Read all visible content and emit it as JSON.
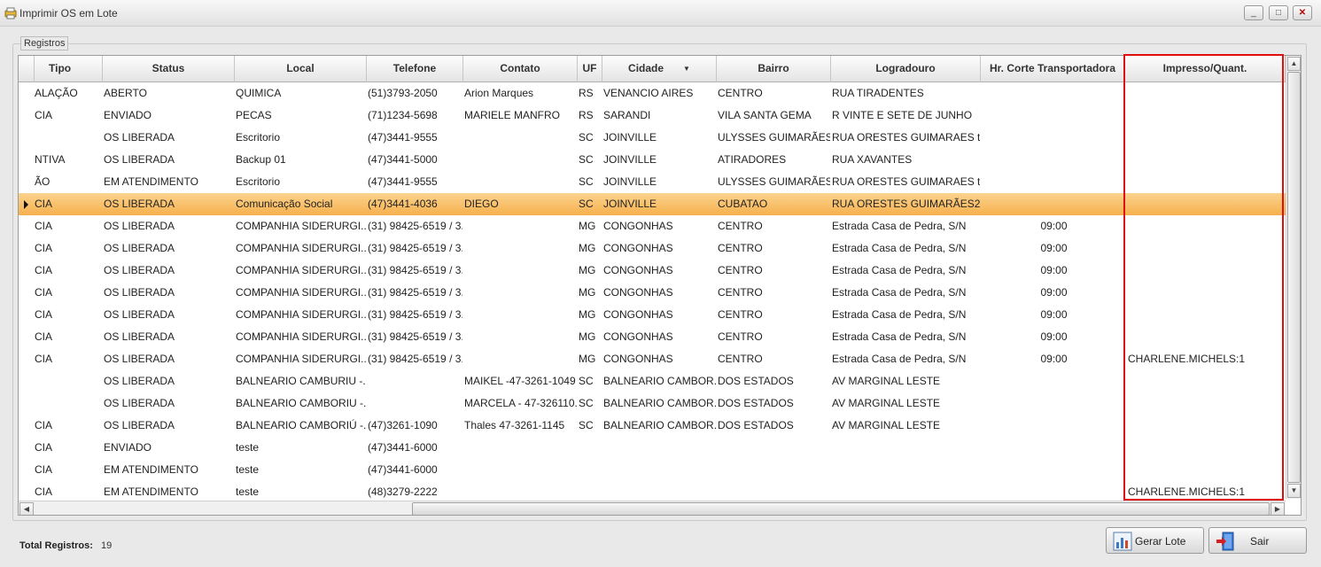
{
  "window": {
    "title": "Imprimir OS em Lote",
    "min_glyph": "_",
    "max_glyph": "□",
    "close_glyph": "✕"
  },
  "groupbox": {
    "label": "Registros"
  },
  "grid": {
    "columns": [
      {
        "key": "tipo",
        "label": "Tipo"
      },
      {
        "key": "status",
        "label": "Status"
      },
      {
        "key": "local",
        "label": "Local"
      },
      {
        "key": "telefone",
        "label": "Telefone"
      },
      {
        "key": "contato",
        "label": "Contato"
      },
      {
        "key": "uf",
        "label": "UF"
      },
      {
        "key": "cidade",
        "label": "Cidade",
        "sorted": true
      },
      {
        "key": "bairro",
        "label": "Bairro"
      },
      {
        "key": "logradouro",
        "label": "Logradouro"
      },
      {
        "key": "hr_corte",
        "label": "Hr. Corte Transportadora"
      },
      {
        "key": "impresso",
        "label": "Impresso/Quant."
      }
    ],
    "sort_glyph": "▼",
    "rows": [
      {
        "tipo": "ALAÇÃO",
        "status": "ABERTO",
        "local": "QUIMICA",
        "telefone": "(51)3793-2050",
        "contato": "Arion Marques",
        "uf": "RS",
        "cidade": "VENANCIO AIRES",
        "bairro": "CENTRO",
        "logradouro": "RUA TIRADENTES",
        "hr_corte": "",
        "impresso": ""
      },
      {
        "tipo": "CIA",
        "status": "ENVIADO",
        "local": "PECAS",
        "telefone": "(71)1234-5698",
        "contato": "MARIELE MANFRO",
        "uf": "RS",
        "cidade": "SARANDI",
        "bairro": "VILA SANTA GEMA",
        "logradouro": "R VINTE E SETE DE JUNHO",
        "hr_corte": "",
        "impresso": ""
      },
      {
        "tipo": "",
        "status": "OS LIBERADA",
        "local": "Escritorio",
        "telefone": "(47)3441-9555",
        "contato": "",
        "uf": "SC",
        "cidade": "JOINVILLE",
        "bairro": "ULYSSES GUIMARÃES",
        "logradouro": "RUA ORESTES GUIMARAES t...",
        "hr_corte": "",
        "impresso": ""
      },
      {
        "tipo": "NTIVA",
        "status": "OS LIBERADA",
        "local": "Backup 01",
        "telefone": "(47)3441-5000",
        "contato": "",
        "uf": "SC",
        "cidade": "JOINVILLE",
        "bairro": "ATIRADORES",
        "logradouro": "RUA XAVANTES",
        "hr_corte": "",
        "impresso": ""
      },
      {
        "tipo": "ÃO",
        "status": "EM ATENDIMENTO",
        "local": "Escritorio",
        "telefone": "(47)3441-9555",
        "contato": "",
        "uf": "SC",
        "cidade": "JOINVILLE",
        "bairro": "ULYSSES GUIMARÃES",
        "logradouro": "RUA ORESTES GUIMARAES t...",
        "hr_corte": "",
        "impresso": ""
      },
      {
        "tipo": "CIA",
        "status": "OS LIBERADA",
        "local": "Comunicação Social",
        "telefone": "(47)3441-4036",
        "contato": "DIEGO",
        "uf": "SC",
        "cidade": "JOINVILLE",
        "bairro": "CUBATAO",
        "logradouro": "RUA ORESTES GUIMARÃES2",
        "hr_corte": "",
        "impresso": "",
        "selected": true
      },
      {
        "tipo": "CIA",
        "status": "OS LIBERADA",
        "local": "COMPANHIA SIDERURGI...",
        "telefone": "(31) 98425-6519 / 3...",
        "contato": "",
        "uf": "MG",
        "cidade": "CONGONHAS",
        "bairro": "CENTRO",
        "logradouro": "Estrada Casa de Pedra, S/N",
        "hr_corte": "09:00",
        "impresso": ""
      },
      {
        "tipo": "CIA",
        "status": "OS LIBERADA",
        "local": "COMPANHIA SIDERURGI...",
        "telefone": "(31) 98425-6519 / 3...",
        "contato": "",
        "uf": "MG",
        "cidade": "CONGONHAS",
        "bairro": "CENTRO",
        "logradouro": "Estrada Casa de Pedra, S/N",
        "hr_corte": "09:00",
        "impresso": ""
      },
      {
        "tipo": "CIA",
        "status": "OS LIBERADA",
        "local": "COMPANHIA SIDERURGI...",
        "telefone": "(31) 98425-6519 / 3...",
        "contato": "",
        "uf": "MG",
        "cidade": "CONGONHAS",
        "bairro": "CENTRO",
        "logradouro": "Estrada Casa de Pedra, S/N",
        "hr_corte": "09:00",
        "impresso": ""
      },
      {
        "tipo": "CIA",
        "status": "OS LIBERADA",
        "local": "COMPANHIA SIDERURGI...",
        "telefone": "(31) 98425-6519 / 3...",
        "contato": "",
        "uf": "MG",
        "cidade": "CONGONHAS",
        "bairro": "CENTRO",
        "logradouro": "Estrada Casa de Pedra, S/N",
        "hr_corte": "09:00",
        "impresso": ""
      },
      {
        "tipo": "CIA",
        "status": "OS LIBERADA",
        "local": "COMPANHIA SIDERURGI...",
        "telefone": "(31) 98425-6519 / 3...",
        "contato": "",
        "uf": "MG",
        "cidade": "CONGONHAS",
        "bairro": "CENTRO",
        "logradouro": "Estrada Casa de Pedra, S/N",
        "hr_corte": "09:00",
        "impresso": ""
      },
      {
        "tipo": "CIA",
        "status": "OS LIBERADA",
        "local": "COMPANHIA SIDERURGI...",
        "telefone": "(31) 98425-6519 / 3...",
        "contato": "",
        "uf": "MG",
        "cidade": "CONGONHAS",
        "bairro": "CENTRO",
        "logradouro": "Estrada Casa de Pedra, S/N",
        "hr_corte": "09:00",
        "impresso": ""
      },
      {
        "tipo": "CIA",
        "status": "OS LIBERADA",
        "local": "COMPANHIA SIDERURGI...",
        "telefone": "(31) 98425-6519 / 3...",
        "contato": "",
        "uf": "MG",
        "cidade": "CONGONHAS",
        "bairro": "CENTRO",
        "logradouro": "Estrada Casa de Pedra, S/N",
        "hr_corte": "09:00",
        "impresso": "CHARLENE.MICHELS:1"
      },
      {
        "tipo": "",
        "status": "OS LIBERADA",
        "local": "BALNEARIO CAMBURIU -...",
        "telefone": "",
        "contato": "MAIKEL -47-3261-1049",
        "uf": "SC",
        "cidade": "BALNEARIO CAMBOR...",
        "bairro": "DOS ESTADOS",
        "logradouro": "AV MARGINAL LESTE",
        "hr_corte": "",
        "impresso": ""
      },
      {
        "tipo": "",
        "status": "OS LIBERADA",
        "local": "BALNEARIO CAMBORIU -...",
        "telefone": "",
        "contato": "MARCELA - 47-326110...",
        "uf": "SC",
        "cidade": "BALNEARIO CAMBOR...",
        "bairro": "DOS ESTADOS",
        "logradouro": "AV MARGINAL LESTE",
        "hr_corte": "",
        "impresso": ""
      },
      {
        "tipo": "CIA",
        "status": "OS LIBERADA",
        "local": "BALNEARIO CAMBORIÚ -...",
        "telefone": "(47)3261-1090",
        "contato": "Thales 47-3261-1145",
        "uf": "SC",
        "cidade": "BALNEARIO CAMBOR...",
        "bairro": "DOS ESTADOS",
        "logradouro": "AV MARGINAL LESTE",
        "hr_corte": "",
        "impresso": ""
      },
      {
        "tipo": "CIA",
        "status": "ENVIADO",
        "local": "teste",
        "telefone": "(47)3441-6000",
        "contato": "",
        "uf": "",
        "cidade": "",
        "bairro": "",
        "logradouro": "",
        "hr_corte": "",
        "impresso": ""
      },
      {
        "tipo": "CIA",
        "status": "EM ATENDIMENTO",
        "local": "teste",
        "telefone": "(47)3441-6000",
        "contato": "",
        "uf": "",
        "cidade": "",
        "bairro": "",
        "logradouro": "",
        "hr_corte": "",
        "impresso": ""
      },
      {
        "tipo": "CIA",
        "status": "EM ATENDIMENTO",
        "local": "teste",
        "telefone": "(48)3279-2222",
        "contato": "",
        "uf": "",
        "cidade": "",
        "bairro": "",
        "logradouro": "",
        "hr_corte": "",
        "impresso": "CHARLENE.MICHELS:1"
      }
    ]
  },
  "scroll_glyphs": {
    "up": "▲",
    "down": "▼",
    "left": "◀",
    "right": "▶"
  },
  "footer": {
    "total_label": "Total Registros:",
    "total_value": "19",
    "gerar_lote_label": "Gerar Lote",
    "sair_label": "Sair"
  },
  "colors": {
    "selected_row": "#f6b04d",
    "highlight_border": "#e01010"
  },
  "icons": {
    "app": "printer-app-icon",
    "gerar": "chart-icon",
    "sair": "exit-door-icon"
  }
}
